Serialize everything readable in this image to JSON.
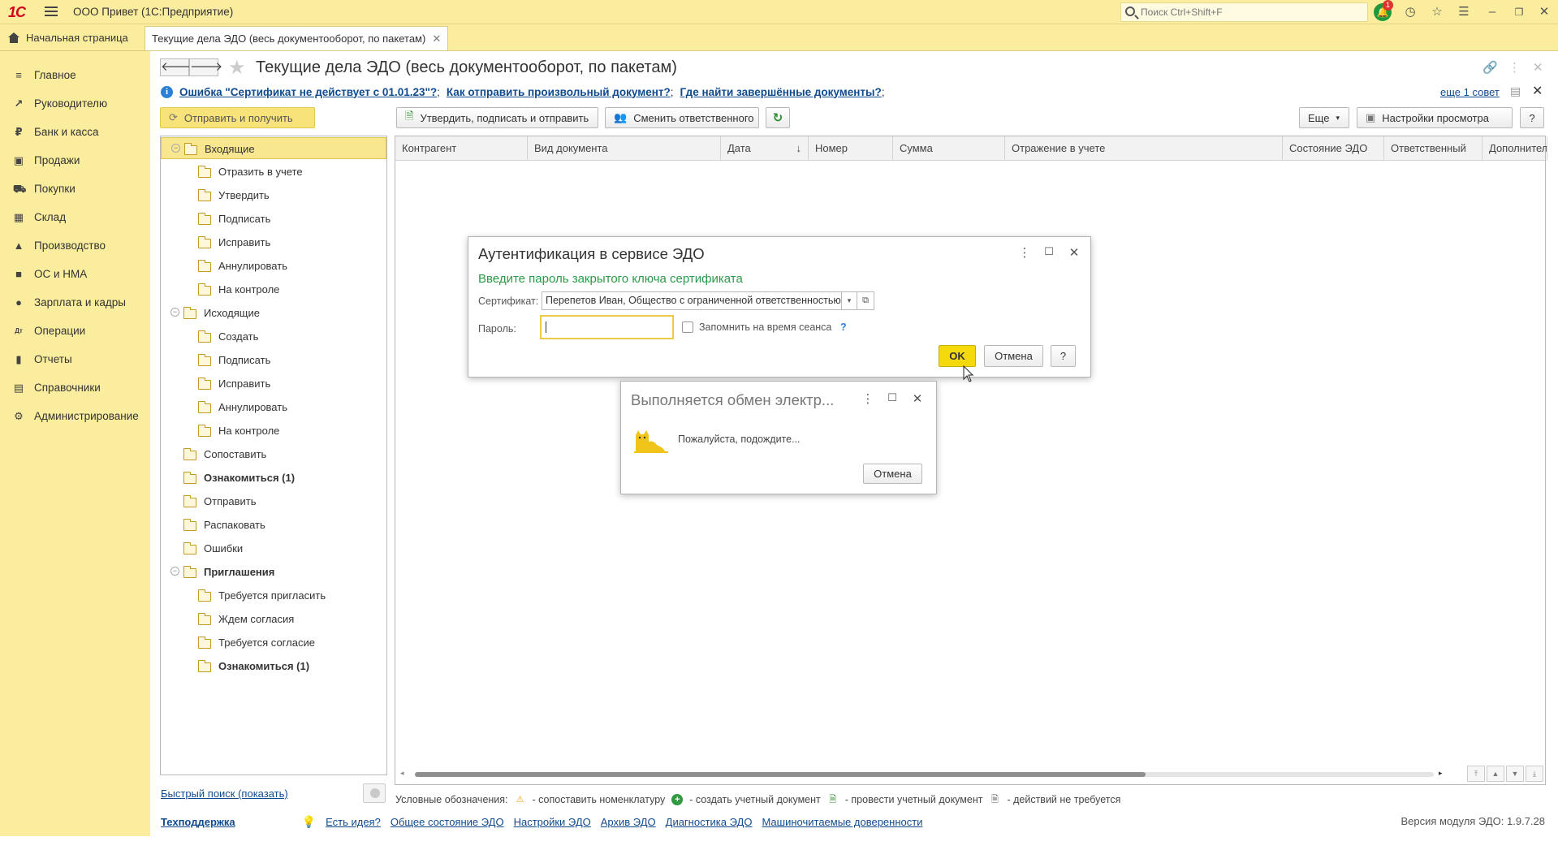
{
  "app": {
    "logo": "1С",
    "title": "ООО Привет  (1С:Предприятие)",
    "search_placeholder": "Поиск Ctrl+Shift+F",
    "notification_count": "1"
  },
  "tabs": {
    "home": "Начальная страница",
    "current": "Текущие дела ЭДО (весь документооборот, по пакетам)"
  },
  "sidebar": {
    "items": [
      {
        "label": "Главное",
        "icon": "≡"
      },
      {
        "label": "Руководителю",
        "icon": "↗"
      },
      {
        "label": "Банк и касса",
        "icon": "₽"
      },
      {
        "label": "Продажи",
        "icon": "▣"
      },
      {
        "label": "Покупки",
        "icon": "⛟"
      },
      {
        "label": "Склад",
        "icon": "▦"
      },
      {
        "label": "Производство",
        "icon": "▲"
      },
      {
        "label": "ОС и НМА",
        "icon": "■"
      },
      {
        "label": "Зарплата и кадры",
        "icon": "●"
      },
      {
        "label": "Операции",
        "icon": "Дт"
      },
      {
        "label": "Отчеты",
        "icon": "▮"
      },
      {
        "label": "Справочники",
        "icon": "▤"
      },
      {
        "label": "Администрирование",
        "icon": "⚙"
      }
    ]
  },
  "page": {
    "title": "Текущие дела ЭДО (весь документооборот, по пакетам)",
    "info_links": [
      "Ошибка \"Сертификат не действует с 01.01.23\"?",
      "Как отправить произвольный документ?",
      "Где найти завершённые документы?"
    ],
    "info_sep": ";",
    "more_tips": "еще 1 совет"
  },
  "toolbar": {
    "send_receive": "Отправить и получить",
    "approve_sign_send": "Утвердить, подписать и отправить",
    "change_responsible": "Сменить ответственного",
    "more": "Еще",
    "view_settings": "Настройки просмотра",
    "help": "?"
  },
  "tree": {
    "rows": [
      {
        "label": "Входящие",
        "level": 0,
        "toggle": "⊖",
        "bold": false,
        "selected": true
      },
      {
        "label": "Отразить в учете",
        "level": 1,
        "bold": false
      },
      {
        "label": "Утвердить",
        "level": 1,
        "bold": false
      },
      {
        "label": "Подписать",
        "level": 1,
        "bold": false
      },
      {
        "label": "Исправить",
        "level": 1,
        "bold": false
      },
      {
        "label": "Аннулировать",
        "level": 1,
        "bold": false
      },
      {
        "label": "На контроле",
        "level": 1,
        "bold": false
      },
      {
        "label": "Исходящие",
        "level": 0,
        "toggle": "⊖",
        "bold": false
      },
      {
        "label": "Создать",
        "level": 1,
        "bold": false
      },
      {
        "label": "Подписать",
        "level": 1,
        "bold": false
      },
      {
        "label": "Исправить",
        "level": 1,
        "bold": false
      },
      {
        "label": "Аннулировать",
        "level": 1,
        "bold": false
      },
      {
        "label": "На контроле",
        "level": 1,
        "bold": false
      },
      {
        "label": "Сопоставить",
        "level": 0,
        "bold": false
      },
      {
        "label": "Ознакомиться (1)",
        "level": 0,
        "bold": true
      },
      {
        "label": "Отправить",
        "level": 0,
        "bold": false
      },
      {
        "label": "Распаковать",
        "level": 0,
        "bold": false
      },
      {
        "label": "Ошибки",
        "level": 0,
        "bold": false
      },
      {
        "label": "Приглашения",
        "level": 0,
        "toggle": "⊖",
        "bold": true
      },
      {
        "label": "Требуется пригласить",
        "level": 1,
        "bold": false
      },
      {
        "label": "Ждем согласия",
        "level": 1,
        "bold": false
      },
      {
        "label": "Требуется согласие",
        "level": 1,
        "bold": false
      },
      {
        "label": "Ознакомиться (1)",
        "level": 1,
        "bold": true
      }
    ]
  },
  "grid": {
    "columns": [
      "Контрагент",
      "Вид документа",
      "Дата",
      "Номер",
      "Сумма",
      "Отражение в учете",
      "Состояние ЭДО",
      "Ответственный",
      "Дополнительно"
    ],
    "sort_indicator": "↓"
  },
  "footer": {
    "quick_search": "Быстрый поиск (показать)",
    "legend_title": "Условные обозначения:",
    "legend_items": [
      {
        "icon": "warning-icon",
        "text": "- сопоставить номенклатуру"
      },
      {
        "icon": "plus-circle-icon",
        "text": "- создать учетный документ"
      },
      {
        "icon": "post-document-icon",
        "text": "- провести учетный документ"
      },
      {
        "icon": "no-action-icon",
        "text": "- действий не требуется"
      }
    ],
    "support": "Техподдержка",
    "links": [
      "Есть идея?",
      "Общее состояние ЭДО",
      "Настройки ЭДО",
      "Архив ЭДО",
      "Диагностика ЭДО",
      "Машиночитаемые доверенности"
    ],
    "version": "Версия модуля ЭДО: 1.9.7.28"
  },
  "auth_dialog": {
    "title": "Аутентификация в сервисе ЭДО",
    "subtitle": "Введите пароль закрытого ключа сертификата",
    "cert_label": "Сертификат:",
    "cert_value": "Перепетов Иван, Общество с ограниченной ответственностью \"Привет\"",
    "password_label": "Пароль:",
    "password_value": "",
    "remember_label": "Запомнить на время сеанса",
    "remember_help": "?",
    "ok": "OK",
    "cancel": "Отмена",
    "help": "?"
  },
  "progress_dialog": {
    "title": "Выполняется обмен электр...",
    "message": "Пожалуйста, подождите...",
    "cancel": "Отмена"
  }
}
